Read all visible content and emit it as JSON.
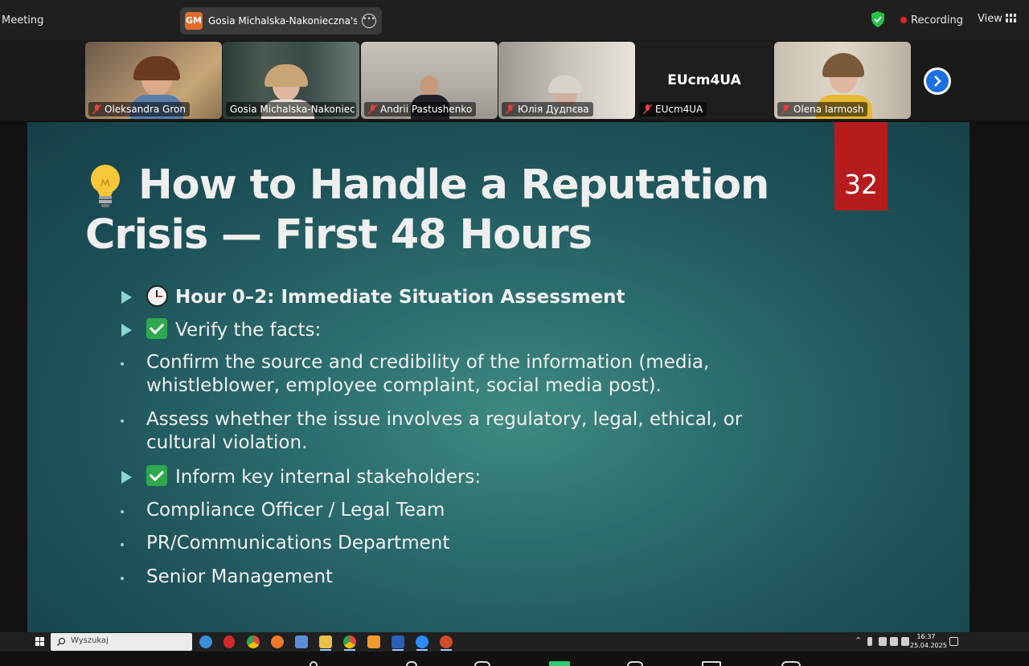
{
  "topbar": {
    "meeting_title": "Meeting",
    "share": {
      "avatar_initials": "GM",
      "label": "Gosia Michalska-Nakonieczna's s",
      "more_icon": "ellipsis-icon"
    },
    "security_icon": "shield-check-icon",
    "recording_label": "Recording",
    "view_label": "View"
  },
  "participants": [
    {
      "name": "Oleksandra Gron",
      "muted": true
    },
    {
      "name": "Gosia Michalska-Nakoniec...",
      "muted": false,
      "active": true
    },
    {
      "name": "Andrii Pastushenko",
      "muted": true
    },
    {
      "name": "Юлія Дудпєва",
      "muted": true
    },
    {
      "name": "EUcm4UA",
      "muted": true,
      "display_name": "EUcm4UA"
    },
    {
      "name": "Olena Iarmosh",
      "muted": true
    }
  ],
  "slide": {
    "number": "32",
    "title_line1": "How to Handle a Reputation",
    "title_line2": "Crisis — First 48 Hours",
    "items": [
      {
        "type": "arrow",
        "icon": "clock-icon",
        "text": "Hour 0–2: Immediate Situation Assessment",
        "bold": true
      },
      {
        "type": "arrow",
        "icon": "check-icon",
        "text": "Verify the facts:"
      },
      {
        "type": "dot",
        "text": "Confirm the source and credibility of the information (media, whistleblower, employee complaint, social media post)."
      },
      {
        "type": "dot",
        "text": "Assess whether the issue involves a regulatory, legal, ethical, or cultural violation."
      },
      {
        "type": "arrow",
        "icon": "check-icon",
        "text": "Inform key internal stakeholders:"
      },
      {
        "type": "dot",
        "text": "Compliance Officer / Legal Team"
      },
      {
        "type": "dot",
        "text": "PR/Communications Department"
      },
      {
        "type": "dot",
        "text": "Senior Management"
      }
    ]
  },
  "taskbar": {
    "search_placeholder": "Wyszukaj",
    "apps": [
      "file-explorer-icon",
      "edge-icon",
      "opera-icon",
      "chrome-icon",
      "firefox-icon",
      "teams-icon",
      "folder-icon",
      "chrome-profile-icon",
      "paint-icon",
      "word-icon",
      "zoom-icon",
      "powerpoint-icon"
    ],
    "time": "16:37",
    "date": "25.04.2025"
  },
  "colors": {
    "slide_number_bg": "#b71c1c",
    "active_speaker": "#2ecc71",
    "recording_dot": "#e02828",
    "next_arrow": "#1b6fe0"
  }
}
